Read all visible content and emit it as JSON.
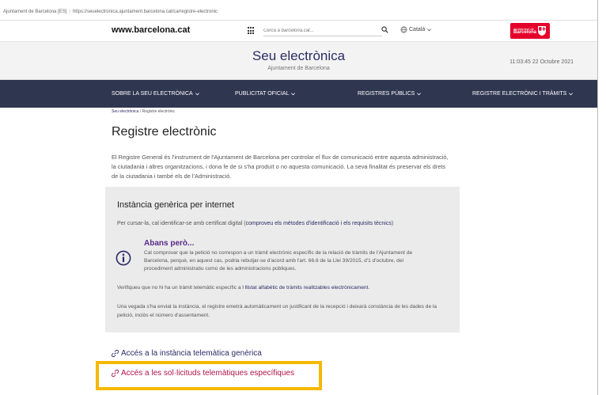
{
  "browser": {
    "tab_label": "Ajuntament de Barcelona [ES]",
    "url": "https://seuelectronica.ajuntament.barcelona.cat/ca/registre-electronic"
  },
  "topbar": {
    "brand": "www.barcelona.cat",
    "search_placeholder": "Cerca a barcelona.cat...",
    "language": "Català",
    "logo_small": "Ajuntament de",
    "logo_big": "Barcelona"
  },
  "header": {
    "title": "Seu electrònica",
    "subtitle": "Ajuntament de Barcelona",
    "clock": "11:03:45  22 Octubre 2021"
  },
  "nav": {
    "items": [
      {
        "label": "SOBRE LA SEU ELECTRÒNICA"
      },
      {
        "label": "PUBLICITAT OFICIAL"
      },
      {
        "label": "REGISTRES PÚBLICS"
      },
      {
        "label": "REGISTRE ELECTRÒNIC I TRÀMITS"
      }
    ]
  },
  "breadcrumb": {
    "home": "Seu electrònica",
    "current": "Registre electrònic"
  },
  "page": {
    "title": "Registre electrònic",
    "intro": "El Registre General és l'instrument de l'Ajuntament de Barcelona per controlar el flux de comunicació entre aquesta administració, la ciutadania i altres organitzacions, i dona fe de si s'ha produït o no aquesta comunicació. La seva finalitat és preservar els drets de la ciutadania i també els de l'Administració."
  },
  "panel": {
    "title": "Instància genèrica per internet",
    "cursar_text": "Per cursar-la, cal identificar-se amb certificat digital (",
    "cursar_link": "comproveu els mètodes d'identificació i els requisits tècnics",
    "cursar_close": ")",
    "abans_title": "Abans però...",
    "abans_text": "Cal comprovar que la petició no correspon a un tràmit electrònic específic de la relació de tràmits de l'Ajuntament de Barcelona, perquè, en aquest cas, podria rebutjar-se d'acord amb l'art. 66.6 de la Llei 39/2015, d'1 d'octubre, del procediment administratiu comú de les administracions públiques.",
    "verify_text": "Verifiqueu que no hi ha un tràmit telemàtic específic a ",
    "verify_link": "l llistat alfabètic de tràmits realitzables electrònicament",
    "verify_end": ".",
    "after_text": "Una vegada s'ha enviat la instància, el registre emetrà automàticament un justificant de la recepció i deixarà constància de les dades de la petició, inclòs el número d'assentament."
  },
  "links": {
    "generic": "Accés a la instància telemàtica genèrica",
    "specific": "Accés a les sol·licituds telemàtiques específiques"
  },
  "colors": {
    "nav_bg": "#2f3650",
    "title": "#2b2b66",
    "brand_red": "#e5002b",
    "highlight": "#f5b800"
  }
}
